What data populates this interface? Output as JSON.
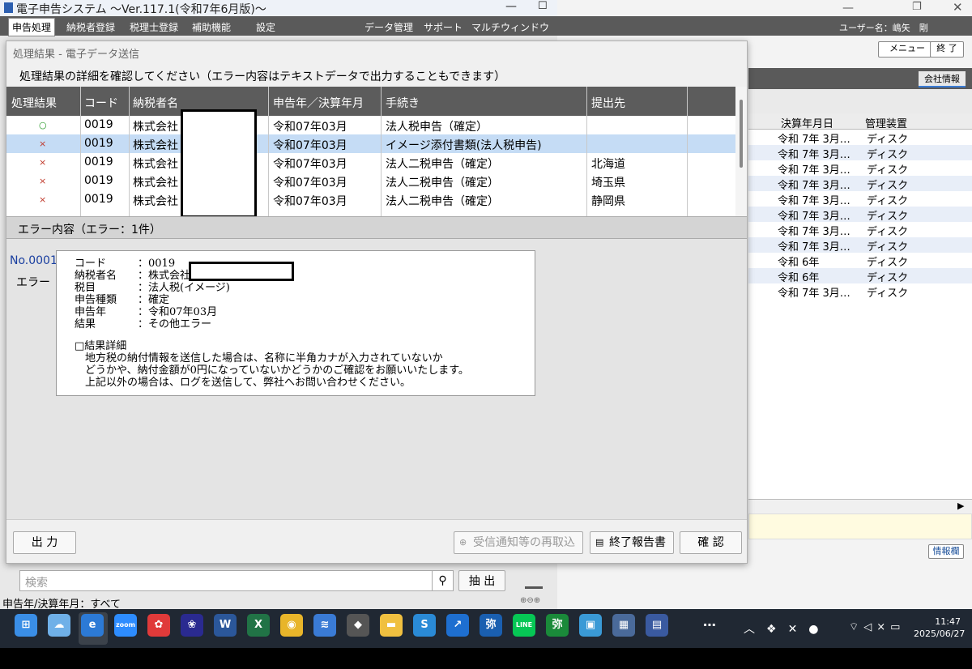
{
  "main": {
    "title": "電子申告システム ～Ver.117.1(令和7年6月版)～",
    "menu": [
      "申告処理",
      "納税者登録",
      "税理士登録",
      "補助機能",
      "設定",
      "データ管理",
      "サポート",
      "マルチウィンドウ"
    ],
    "search_placeholder": "検索",
    "extract_button": "抽 出",
    "status_filter": "申告年/決算年月：すべて"
  },
  "right_window": {
    "user_label": "ユーザー名：嶋矢　剛",
    "menu_button": "メニュー",
    "close_button": "終 了",
    "company_tab": "会社情報",
    "columns": [
      "決算年月日",
      "管理装置"
    ],
    "rows": [
      {
        "date": "令和 7年 3月…",
        "device": "ディスク"
      },
      {
        "date": "令和 7年 3月…",
        "device": "ディスク"
      },
      {
        "date": "令和 7年 3月…",
        "device": "ディスク"
      },
      {
        "date": "令和 7年 3月…",
        "device": "ディスク"
      },
      {
        "date": "令和 7年 3月…",
        "device": "ディスク"
      },
      {
        "date": "令和 7年 3月…",
        "device": "ディスク"
      },
      {
        "date": "令和 7年 3月…",
        "device": "ディスク"
      },
      {
        "date": "令和 7年 3月…",
        "device": "ディスク"
      },
      {
        "date": "令和 6年",
        "device": "ディスク"
      },
      {
        "date": "令和 6年",
        "device": "ディスク"
      },
      {
        "date": "令和 7年 3月…",
        "device": "ディスク"
      }
    ],
    "info_button": "情報欄"
  },
  "dialog": {
    "title": "処理結果 - 電子データ送信",
    "instruction": "処理結果の詳細を確認してください（エラー内容はテキストデータで出力することもできます）",
    "columns": [
      "処理結果",
      "コード",
      "納税者名",
      "申告年／決算年月",
      "手続き",
      "提出先"
    ],
    "rows": [
      {
        "result": "○",
        "code": "0019",
        "name": "株式会社",
        "period": "令和07年03月",
        "procedure": "法人税申告（確定）",
        "dest": ""
      },
      {
        "result": "×",
        "code": "0019",
        "name": "株式会社",
        "period": "令和07年03月",
        "procedure": "イメージ添付書類(法人税申告)",
        "dest": ""
      },
      {
        "result": "×",
        "code": "0019",
        "name": "株式会社",
        "period": "令和07年03月",
        "procedure": "法人二税申告（確定）",
        "dest": "北海道"
      },
      {
        "result": "×",
        "code": "0019",
        "name": "株式会社",
        "period": "令和07年03月",
        "procedure": "法人二税申告（確定）",
        "dest": "埼玉県"
      },
      {
        "result": "×",
        "code": "0019",
        "name": "株式会社",
        "period": "令和07年03月",
        "procedure": "法人二税申告（確定）",
        "dest": "静岡県"
      }
    ],
    "error_header": "エラー内容（エラー：1件）",
    "error_no": "No.0001",
    "error_label": "エラー",
    "error_lines": [
      "コード　　　：0019",
      "納税者名　　：株式会社",
      "税目　　　　：法人税(イメージ)",
      "申告種類　　：確定",
      "申告年　　　：令和07年03月",
      "結果　　　　：その他エラー"
    ],
    "detail_title": "□結果詳細",
    "detail_lines": [
      "　地方税の納付情報を送信した場合は、名称に半角カナが入力されていないか",
      "　どうかや、納付金額が0円になっていないかどうかのご確認をお願いいたします。",
      "　上記以外の場合は、ログを送信して、弊社へお問い合わせください。"
    ],
    "output_button": "出 力",
    "reacquire_button": "受信通知等の再取込",
    "report_button": "終了報告書",
    "confirm_button": "確 認"
  },
  "taskbar": {
    "time": "11:47",
    "date": "2025/06/27",
    "icons": [
      "start-icon",
      "weather-icon",
      "edge-icon",
      "zoom-icon",
      "app-red-icon",
      "app-yellow-icon",
      "word-icon",
      "excel-icon",
      "chrome-icon",
      "app-wave-icon",
      "app-dark-icon",
      "explorer-icon",
      "app-s-icon",
      "app-arrow-icon",
      "yayoi-icon",
      "line-icon",
      "yayoi2-icon",
      "app-screen-icon",
      "app-calc-icon",
      "app-doc-icon",
      "more-icon"
    ]
  }
}
